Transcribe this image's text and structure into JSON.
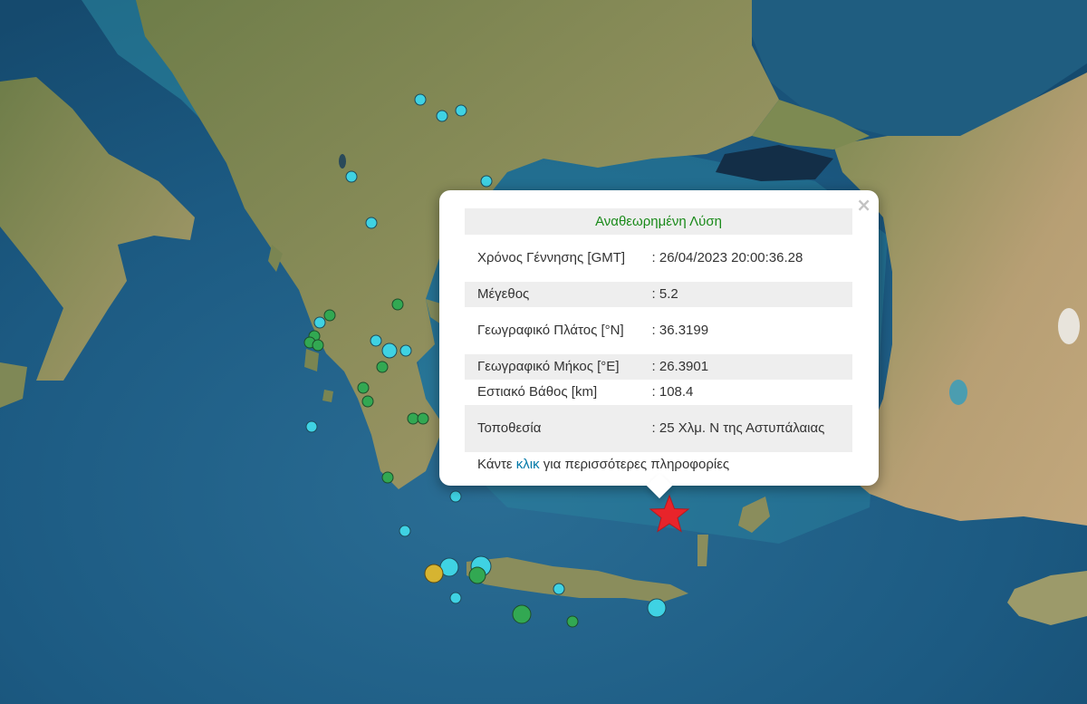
{
  "popup": {
    "close_label": "×",
    "header": "Αναθεωρημένη Λύση",
    "rows": [
      {
        "label": "Χρόνος Γέννησης [GMT]",
        "value": ": 26/04/2023 20:00:36.28"
      },
      {
        "label": "Μέγεθος",
        "value": ": 5.2"
      },
      {
        "label": "Γεωγραφικό Πλάτος [°N]",
        "value": ": 36.3199"
      },
      {
        "label": "Γεωγραφικό Μήκος [°E]",
        "value": ": 26.3901"
      },
      {
        "label": "Εστιακό Βάθος [km]",
        "value": ": 108.4"
      },
      {
        "label": "Τοποθεσία",
        "value": ": 25 Χλμ. Ν της Αστυπάλαιας"
      }
    ],
    "more_prefix": "Κάντε ",
    "more_link": "κλικ",
    "more_suffix": " για περισσότερες πληροφορίες"
  },
  "colors": {
    "sea": "#1d5f86",
    "land": "#7c8a55",
    "marker_cyan": "#3fd2e3",
    "marker_green": "#32a852",
    "marker_yellow": "#d6b431",
    "epicenter": "#e8242a",
    "link": "#0078a8",
    "header_text": "#1a8a1a"
  },
  "markers": {
    "epicenter_icon": "star-icon",
    "legend": []
  }
}
